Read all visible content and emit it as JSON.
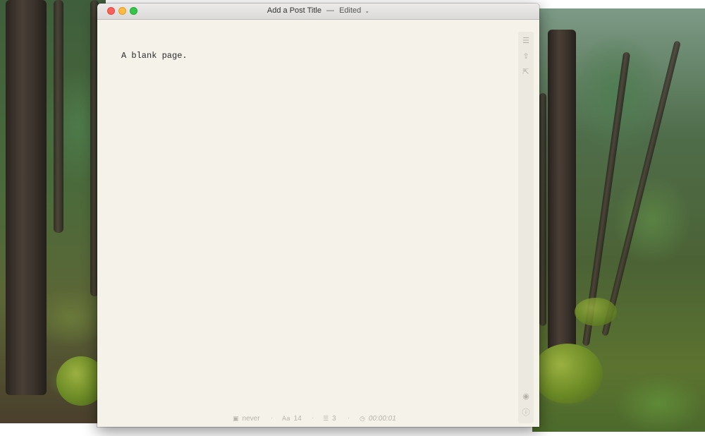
{
  "window": {
    "title_main": "Add a Post Title",
    "title_separator": "—",
    "title_status": "Edited"
  },
  "editor": {
    "text": "A blank page."
  },
  "sidebar": {
    "icons": [
      "list-icon",
      "share-icon",
      "export-icon",
      "eye-icon",
      "info-icon"
    ]
  },
  "statusbar": {
    "last_saved": "never",
    "font_size": "14",
    "paragraphs": "3",
    "reading_time": "00:00:01"
  },
  "colors": {
    "window_bg": "#f5f2ea",
    "close": "#fc605b",
    "minimize": "#fdbc40",
    "zoom": "#34c84a"
  }
}
